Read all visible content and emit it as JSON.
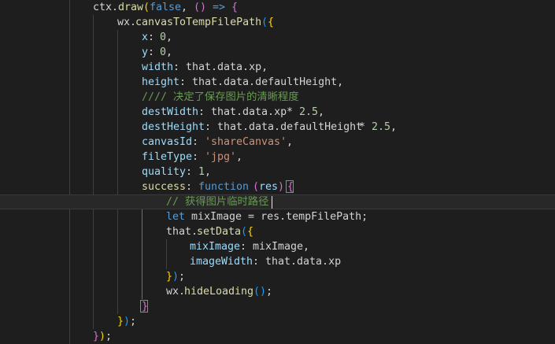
{
  "colors": {
    "background": "#1e1e1e",
    "plain": "#d4d4d4",
    "property": "#9cdcfe",
    "function": "#dcdcaa",
    "number": "#b5cea8",
    "string": "#ce9178",
    "keyword": "#569cd6",
    "control": "#c586c0",
    "comment": "#6a9955",
    "bracket_gold": "#ffd700",
    "bracket_purple": "#da70d6",
    "bracket_blue": "#179fff"
  },
  "code": {
    "l1": {
      "a": "ctx.",
      "b": "draw",
      "c": "(",
      "d": "false",
      "e": ", ",
      "f": "()",
      "g": " => ",
      "h": "{"
    },
    "l2": {
      "a": "wx.",
      "b": "canvasToTempFilePath",
      "c": "(",
      "d": "{"
    },
    "l3": {
      "a": "x",
      "b": ": ",
      "c": "0",
      "d": ","
    },
    "l4": {
      "a": "y",
      "b": ": ",
      "c": "0",
      "d": ","
    },
    "l5": {
      "a": "width",
      "b": ": that.data.xp,"
    },
    "l6": {
      "a": "height",
      "b": ": that.data.defaultHeight,"
    },
    "l7": {
      "a": "//// 决定了保存图片的清晰程度"
    },
    "l8": {
      "a": "destWidth",
      "b": ": that.data.xp ",
      "c": "*",
      "d": " ",
      "e": "2.5",
      "f": ","
    },
    "l9": {
      "a": "destHeight",
      "b": ": that.data.defaultHeight ",
      "c": "*",
      "d": " ",
      "e": "2.5",
      "f": ","
    },
    "l10": {
      "a": "canvasId",
      "b": ": ",
      "c": "'shareCanvas'",
      "d": ","
    },
    "l11": {
      "a": "fileType",
      "b": ": ",
      "c": "'jpg'",
      "d": ","
    },
    "l12": {
      "a": "quality",
      "b": ": ",
      "c": "1",
      "d": ","
    },
    "l13": {
      "a": "success",
      "b": ": ",
      "c": "function",
      "d": " ",
      "e": "(",
      "f": "res",
      "g": ")",
      "h": " ",
      "i": "{"
    },
    "l14": {
      "a": "// 获得图片临时路径"
    },
    "l15": {
      "a": "let",
      "b": " mixImage = res.tempFilePath;"
    },
    "l16": {
      "a": "that.",
      "b": "setData",
      "c": "(",
      "d": "{"
    },
    "l17": {
      "a": "mixImage",
      "b": ": mixImage,"
    },
    "l18": {
      "a": "imageWidth",
      "b": ": that.data.xp"
    },
    "l19": {
      "a": "}",
      "b": ")",
      "c": ";"
    },
    "l20": {
      "a": "wx.",
      "b": "hideLoading",
      "c": "()",
      "d": ";"
    },
    "l21": {
      "a": "}"
    },
    "l22": {
      "a": "}",
      "b": ")",
      "c": ";"
    },
    "l23": {
      "a": "}",
      "b": ")",
      "c": ";"
    }
  }
}
